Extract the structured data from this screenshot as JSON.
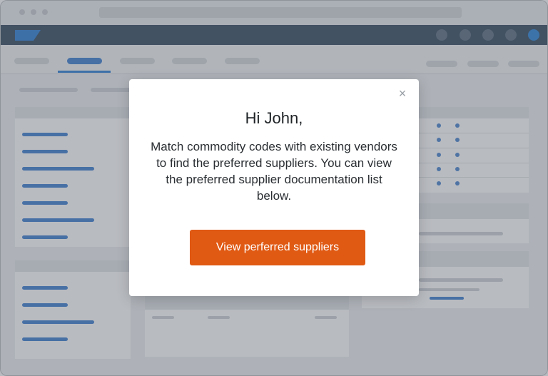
{
  "background_app": {
    "window_controls": [
      "window-dot-1",
      "window-dot-2",
      "window-dot-3"
    ],
    "brand_color": "#2b7fd4",
    "nav_color": "#354a5f",
    "active_tab_index": 1
  },
  "modal": {
    "close_icon": "close-icon",
    "close_glyph": "×",
    "greeting": "Hi John,",
    "message": "Match commodity codes with existing vendors to find the preferred suppliers. You can view the preferred supplier documentation list below.",
    "cta_label": "View perferred suppliers",
    "cta_color": "#e05a14"
  }
}
